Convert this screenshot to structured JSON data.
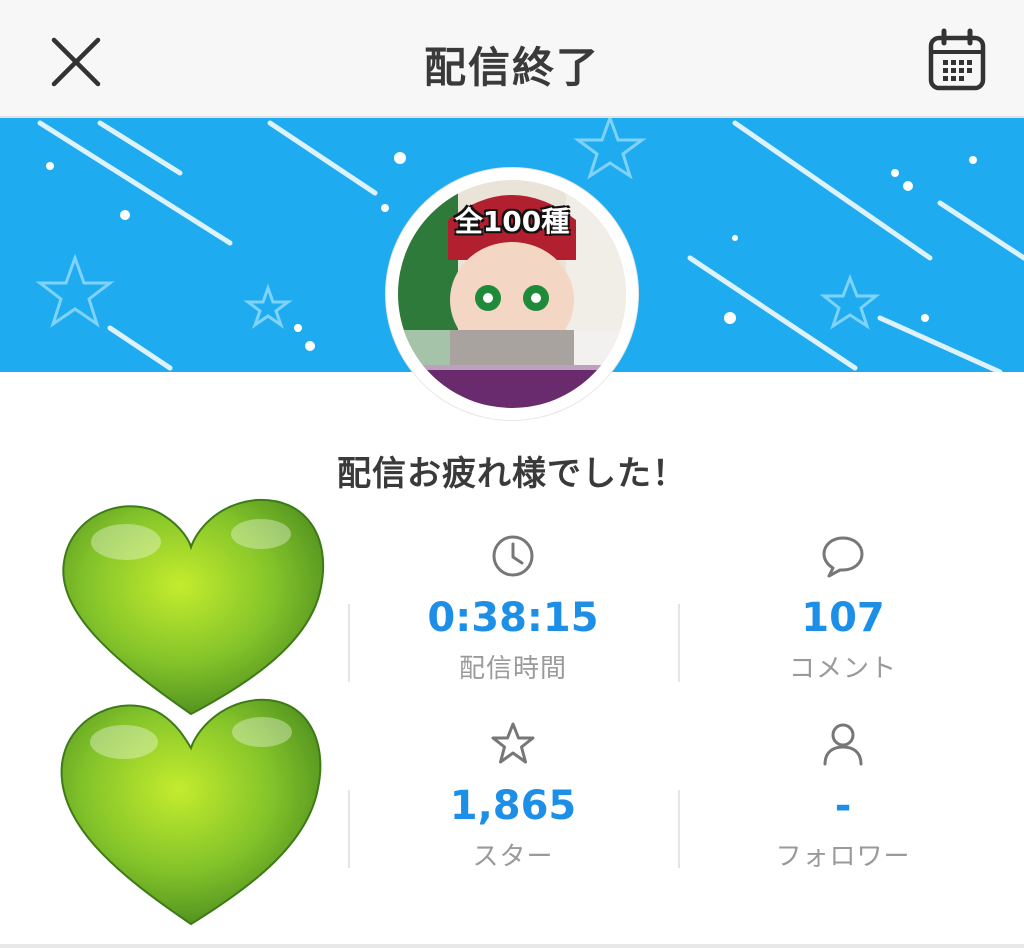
{
  "header": {
    "title": "配信終了",
    "close_icon": "close-icon",
    "calendar_icon": "calendar-icon"
  },
  "banner": {
    "background_color": "#1fabf0",
    "avatar_caption": "全100種"
  },
  "greeting": "配信お疲れ様でした！",
  "stats": {
    "duration": {
      "icon": "clock-icon",
      "value": "0:38:15",
      "label": "配信時間"
    },
    "comments": {
      "icon": "comment-icon",
      "value": "107",
      "label": "コメント"
    },
    "stars": {
      "icon": "star-icon",
      "value": "1,865",
      "label": "スター"
    },
    "followers": {
      "icon": "person-icon",
      "value": "-",
      "label": "フォロワー"
    }
  },
  "colors": {
    "accent": "#1e8fe6",
    "label_gray": "#9a9a9a",
    "heart_green": "#7cc427"
  }
}
